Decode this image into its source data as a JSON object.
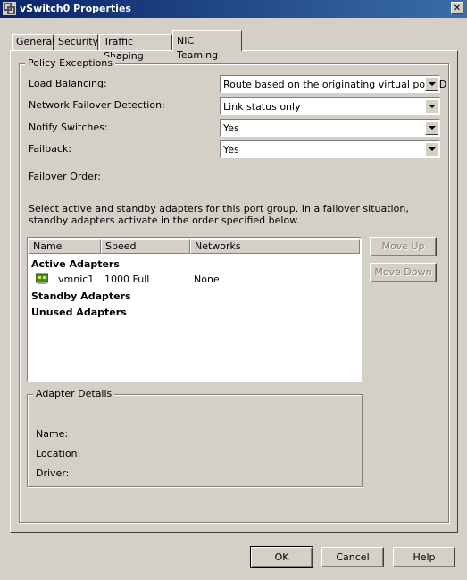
{
  "window": {
    "title": "vSwitch0 Properties",
    "close_glyph": "✕"
  },
  "tabs": [
    {
      "label": "General"
    },
    {
      "label": "Security"
    },
    {
      "label": "Traffic Shaping"
    },
    {
      "label": "NIC Teaming",
      "active": true
    }
  ],
  "policy": {
    "group_label": "Policy Exceptions",
    "load_balancing_label": "Load Balancing:",
    "load_balancing_value": "Route based on the originating virtual port ID",
    "failover_detection_label": "Network Failover Detection:",
    "failover_detection_value": "Link status only",
    "notify_switches_label": "Notify Switches:",
    "notify_switches_value": "Yes",
    "failback_label": "Failback:",
    "failback_value": "Yes",
    "failover_order_label": "Failover Order:"
  },
  "instructions": "Select active and standby adapters for this port group.  In a failover situation, standby adapters activate  in the order specified below.",
  "adapters": {
    "columns": [
      "Name",
      "Speed",
      "Networks"
    ],
    "active_label": "Active Adapters",
    "active": [
      {
        "name": "vmnic1",
        "speed": "1000 Full",
        "networks": "None"
      }
    ],
    "standby_label": "Standby Adapters",
    "unused_label": "Unused Adapters"
  },
  "order_buttons": {
    "move_up": "Move Up",
    "move_down": "Move Down"
  },
  "adapter_details": {
    "group_label": "Adapter Details",
    "name_label": "Name:",
    "location_label": "Location:",
    "driver_label": "Driver:"
  },
  "footer": {
    "ok": "OK",
    "cancel": "Cancel",
    "help": "Help"
  },
  "icons": {
    "app": "vmware-logo-icon",
    "adapter": "nic-icon"
  },
  "colors": {
    "titlebar_start": "#0a246a",
    "titlebar_end": "#3a6ea5",
    "dialog_bg": "#d4d0c8",
    "nic_green": "#3c8c2c"
  }
}
